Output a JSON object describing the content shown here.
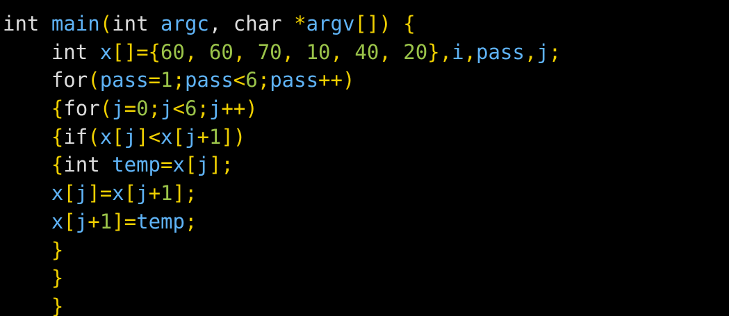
{
  "editor": {
    "colors": {
      "background": "#000000",
      "keyword": "#5fb3f6",
      "number": "#9bc44a",
      "punctuation": "#f0d000",
      "text": "#dcdcdc"
    },
    "lines": [
      [
        {
          "t": "int",
          "c": "txt"
        },
        {
          "t": " ",
          "c": "txt"
        },
        {
          "t": "main",
          "c": "kw"
        },
        {
          "t": "(",
          "c": "pun"
        },
        {
          "t": "int",
          "c": "txt"
        },
        {
          "t": " ",
          "c": "txt"
        },
        {
          "t": "argc",
          "c": "kw"
        },
        {
          "t": ", ",
          "c": "txt"
        },
        {
          "t": "char",
          "c": "txt"
        },
        {
          "t": " ",
          "c": "txt"
        },
        {
          "t": "*",
          "c": "pun"
        },
        {
          "t": "argv",
          "c": "kw"
        },
        {
          "t": "[])",
          "c": "pun"
        },
        {
          "t": " ",
          "c": "txt"
        },
        {
          "t": "{",
          "c": "pun"
        }
      ],
      [
        {
          "t": "    ",
          "c": "txt"
        },
        {
          "t": "int",
          "c": "txt"
        },
        {
          "t": " ",
          "c": "txt"
        },
        {
          "t": "x",
          "c": "kw"
        },
        {
          "t": "[]={",
          "c": "pun"
        },
        {
          "t": "60",
          "c": "num"
        },
        {
          "t": ", ",
          "c": "pun"
        },
        {
          "t": "60",
          "c": "num"
        },
        {
          "t": ", ",
          "c": "pun"
        },
        {
          "t": "70",
          "c": "num"
        },
        {
          "t": ", ",
          "c": "pun"
        },
        {
          "t": "10",
          "c": "num"
        },
        {
          "t": ", ",
          "c": "pun"
        },
        {
          "t": "40",
          "c": "num"
        },
        {
          "t": ", ",
          "c": "pun"
        },
        {
          "t": "20",
          "c": "num"
        },
        {
          "t": "},",
          "c": "pun"
        },
        {
          "t": "i",
          "c": "kw"
        },
        {
          "t": ",",
          "c": "pun"
        },
        {
          "t": "pass",
          "c": "kw"
        },
        {
          "t": ",",
          "c": "pun"
        },
        {
          "t": "j",
          "c": "kw"
        },
        {
          "t": ";",
          "c": "pun"
        }
      ],
      [
        {
          "t": "    ",
          "c": "txt"
        },
        {
          "t": "for",
          "c": "txt"
        },
        {
          "t": "(",
          "c": "pun"
        },
        {
          "t": "pass",
          "c": "kw"
        },
        {
          "t": "=",
          "c": "pun"
        },
        {
          "t": "1",
          "c": "num"
        },
        {
          "t": ";",
          "c": "pun"
        },
        {
          "t": "pass",
          "c": "kw"
        },
        {
          "t": "<",
          "c": "pun"
        },
        {
          "t": "6",
          "c": "num"
        },
        {
          "t": ";",
          "c": "pun"
        },
        {
          "t": "pass",
          "c": "kw"
        },
        {
          "t": "++)",
          "c": "pun"
        }
      ],
      [
        {
          "t": "    ",
          "c": "txt"
        },
        {
          "t": "{",
          "c": "pun"
        },
        {
          "t": "for",
          "c": "txt"
        },
        {
          "t": "(",
          "c": "pun"
        },
        {
          "t": "j",
          "c": "kw"
        },
        {
          "t": "=",
          "c": "pun"
        },
        {
          "t": "0",
          "c": "num"
        },
        {
          "t": ";",
          "c": "pun"
        },
        {
          "t": "j",
          "c": "kw"
        },
        {
          "t": "<",
          "c": "pun"
        },
        {
          "t": "6",
          "c": "num"
        },
        {
          "t": ";",
          "c": "pun"
        },
        {
          "t": "j",
          "c": "kw"
        },
        {
          "t": "++)",
          "c": "pun"
        }
      ],
      [
        {
          "t": "    ",
          "c": "txt"
        },
        {
          "t": "{",
          "c": "pun"
        },
        {
          "t": "if",
          "c": "txt"
        },
        {
          "t": "(",
          "c": "pun"
        },
        {
          "t": "x",
          "c": "kw"
        },
        {
          "t": "[",
          "c": "pun"
        },
        {
          "t": "j",
          "c": "kw"
        },
        {
          "t": "]<",
          "c": "pun"
        },
        {
          "t": "x",
          "c": "kw"
        },
        {
          "t": "[",
          "c": "pun"
        },
        {
          "t": "j",
          "c": "kw"
        },
        {
          "t": "+",
          "c": "pun"
        },
        {
          "t": "1",
          "c": "num"
        },
        {
          "t": "])",
          "c": "pun"
        }
      ],
      [
        {
          "t": "    ",
          "c": "txt"
        },
        {
          "t": "{",
          "c": "pun"
        },
        {
          "t": "int",
          "c": "txt"
        },
        {
          "t": " ",
          "c": "txt"
        },
        {
          "t": "temp",
          "c": "kw"
        },
        {
          "t": "=",
          "c": "pun"
        },
        {
          "t": "x",
          "c": "kw"
        },
        {
          "t": "[",
          "c": "pun"
        },
        {
          "t": "j",
          "c": "kw"
        },
        {
          "t": "];",
          "c": "pun"
        }
      ],
      [
        {
          "t": "    ",
          "c": "txt"
        },
        {
          "t": "x",
          "c": "kw"
        },
        {
          "t": "[",
          "c": "pun"
        },
        {
          "t": "j",
          "c": "kw"
        },
        {
          "t": "]=",
          "c": "pun"
        },
        {
          "t": "x",
          "c": "kw"
        },
        {
          "t": "[",
          "c": "pun"
        },
        {
          "t": "j",
          "c": "kw"
        },
        {
          "t": "+",
          "c": "pun"
        },
        {
          "t": "1",
          "c": "num"
        },
        {
          "t": "];",
          "c": "pun"
        }
      ],
      [
        {
          "t": "    ",
          "c": "txt"
        },
        {
          "t": "x",
          "c": "kw"
        },
        {
          "t": "[",
          "c": "pun"
        },
        {
          "t": "j",
          "c": "kw"
        },
        {
          "t": "+",
          "c": "pun"
        },
        {
          "t": "1",
          "c": "num"
        },
        {
          "t": "]=",
          "c": "pun"
        },
        {
          "t": "temp",
          "c": "kw"
        },
        {
          "t": ";",
          "c": "pun"
        }
      ],
      [
        {
          "t": "    ",
          "c": "txt"
        },
        {
          "t": "}",
          "c": "pun"
        }
      ],
      [
        {
          "t": "    ",
          "c": "txt"
        },
        {
          "t": "}",
          "c": "pun"
        }
      ],
      [
        {
          "t": "    ",
          "c": "txt"
        },
        {
          "t": "}",
          "c": "pun"
        }
      ]
    ]
  }
}
